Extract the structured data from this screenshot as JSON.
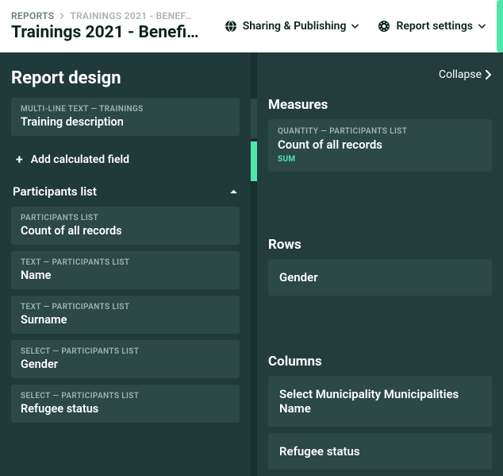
{
  "breadcrumb": {
    "root": "REPORTS",
    "current": "TRAININGS 2021 - BENEF…"
  },
  "page_title": "Trainings 2021 - Benefici…",
  "header_buttons": {
    "sharing": "Sharing & Publishing",
    "settings": "Report settings"
  },
  "left": {
    "title": "Report design",
    "top_field": {
      "meta": "MULTI-LINE TEXT — TRAININGS",
      "label": "Training description"
    },
    "add_calc": "Add calculated field",
    "group": {
      "title": "Participants list",
      "fields": [
        {
          "meta": "PARTICIPANTS LIST",
          "label": "Count of all records"
        },
        {
          "meta": "TEXT — PARTICIPANTS LIST",
          "label": "Name"
        },
        {
          "meta": "TEXT — PARTICIPANTS LIST",
          "label": "Surname"
        },
        {
          "meta": "SELECT — PARTICIPANTS LIST",
          "label": "Gender"
        },
        {
          "meta": "SELECT — PARTICIPANTS LIST",
          "label": "Refugee status"
        }
      ]
    }
  },
  "right": {
    "collapse": "Collapse",
    "measures": {
      "title": "Measures",
      "items": [
        {
          "meta": "QUANTITY — PARTICIPANTS LIST",
          "label": "Count of all records",
          "agg": "SUM"
        }
      ]
    },
    "rows": {
      "title": "Rows",
      "items": [
        "Gender"
      ]
    },
    "columns": {
      "title": "Columns",
      "items": [
        "Select Municipality Municipalities Name",
        "Refugee status"
      ]
    }
  }
}
